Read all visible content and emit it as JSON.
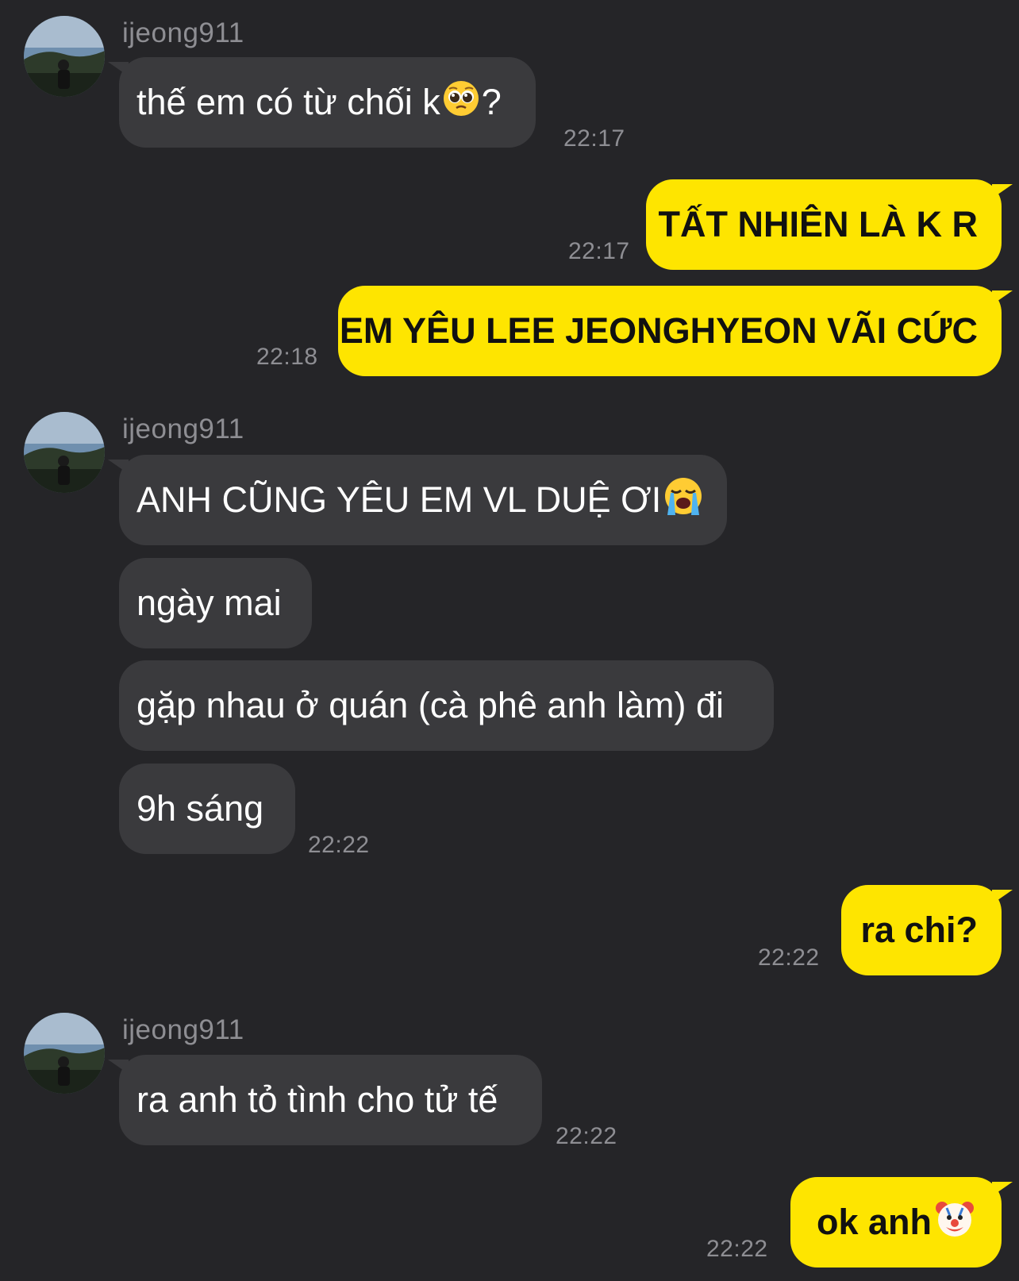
{
  "colors": {
    "background": "#252528",
    "incoming_bubble": "#3a3a3d",
    "outgoing_bubble": "#fee500",
    "meta_text": "#8e8e93"
  },
  "messages": [
    {
      "sender": "ijeong911",
      "text": "thế em có từ chối k",
      "emoji": "pleading-face-icon",
      "suffix": "?",
      "time": "22:17"
    },
    {
      "text": "TẤT NHIÊN LÀ K R",
      "time": "22:17"
    },
    {
      "text": "EM YÊU LEE JEONGHYEON VÃI CỨC",
      "time": "22:18"
    },
    {
      "sender": "ijeong911",
      "text": "ANH CŨNG YÊU EM VL DUỆ ƠI",
      "emoji": "loudly-crying-face-icon"
    },
    {
      "text": "ngày mai"
    },
    {
      "text": "gặp nhau ở quán (cà phê anh làm) đi"
    },
    {
      "text": "9h sáng",
      "time": "22:22"
    },
    {
      "text": "ra chi?",
      "time": "22:22"
    },
    {
      "sender": "ijeong911",
      "text": "ra anh tỏ tình cho tử tế",
      "time": "22:22"
    },
    {
      "text": "ok anh",
      "emoji": "clown-face-icon",
      "time": "22:22"
    }
  ]
}
